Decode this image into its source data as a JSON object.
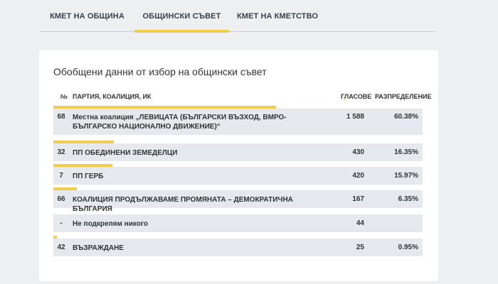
{
  "tabs": [
    {
      "label": "КМЕТ НА ОБЩИНА"
    },
    {
      "label": "ОБЩИНСКИ СЪВЕТ"
    },
    {
      "label": "КМЕТ НА КМЕТСТВО"
    }
  ],
  "card": {
    "title": "Обобщени данни от избор на общински съвет",
    "headers": {
      "no": "№",
      "party": "ПАРТИЯ, КОАЛИЦИЯ, ИК",
      "votes": "ГЛАСОВЕ",
      "distribution": "РАЗПРЕДЕЛЕНИЕ"
    },
    "rows": [
      {
        "no": "68",
        "party": "Местна коалиция „ЛЕВИЦАТА (БЪЛГАРСКИ ВЪЗХОД, ВМРО-БЪЛГАРСКО НАЦИОНАЛНО ДВИЖЕНИЕ)“",
        "votes": "1 588",
        "distribution": "60.38%",
        "share": 0.6038
      },
      {
        "no": "32",
        "party": "ПП ОБЕДИНЕНИ ЗЕМЕДЕЛЦИ",
        "votes": "430",
        "distribution": "16.35%",
        "share": 0.1635
      },
      {
        "no": "7",
        "party": "ПП ГЕРБ",
        "votes": "420",
        "distribution": "15.97%",
        "share": 0.1597
      },
      {
        "no": "66",
        "party": "КОАЛИЦИЯ ПРОДЪЛЖАВАМЕ ПРОМЯНАТА – ДЕМОКРАТИЧНА БЪЛГАРИЯ",
        "votes": "167",
        "distribution": "6.35%",
        "share": 0.0635
      },
      {
        "no": "-",
        "party": "Не подкрепям никого",
        "votes": "44",
        "distribution": "",
        "share": 0
      },
      {
        "no": "42",
        "party": "ВЪЗРАЖДАНЕ",
        "votes": "25",
        "distribution": "0.95%",
        "share": 0.0095
      }
    ]
  },
  "colors": {
    "accent": "#f3cd4a",
    "row_bg": "#e5e8ec",
    "page_bg": "#edeff1"
  }
}
